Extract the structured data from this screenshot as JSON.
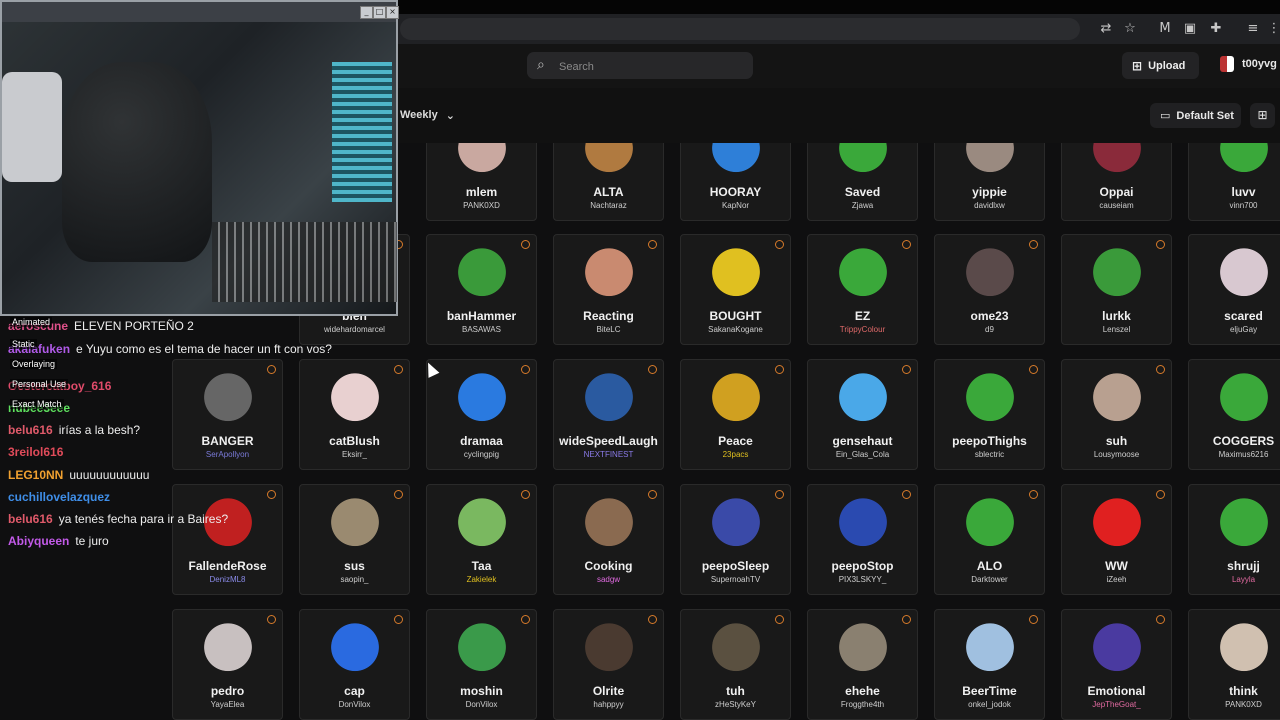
{
  "header": {
    "search_placeholder": "Search",
    "upload_label": "Upload",
    "username": "t00yvg",
    "period_label": "Weekly",
    "set_label": "Default Set"
  },
  "overlay_menu": [
    "Animated",
    "Static",
    "Overlaying",
    "Personal Use",
    "Exact Match"
  ],
  "chat": [
    {
      "user": "aeroscune",
      "text": "ELEVEN PORTEÑO 2",
      "color": "#e0508a"
    },
    {
      "user": "akalafuken",
      "text": "e Yuyu como es el tema de hacer un ft con vos?",
      "color": "#b05ae8"
    },
    {
      "user": "Oestercatboy_616",
      "text": "",
      "color": "#e04b6a"
    },
    {
      "user": "nubee3eee",
      "text": "",
      "color": "#5ee05e"
    },
    {
      "user": "belu616",
      "text": "irías a la besh?",
      "color": "#e05a6a"
    },
    {
      "user": "3reilol616",
      "text": "",
      "color": "#e04b5a"
    },
    {
      "user": "LEG10NN",
      "text": "uuuuuuuuuuuu",
      "color": "#f0a030"
    },
    {
      "user": "cuchillovelazquez",
      "text": "",
      "color": "#3f8ee8"
    },
    {
      "user": "belu616",
      "text": "ya tenés fecha para ir a Baires?",
      "color": "#e05a6a"
    },
    {
      "user": "Abiyqueen",
      "text": "te juro",
      "color": "#c25ae8"
    }
  ],
  "emotes": [
    {
      "name": "mlem",
      "author": "PANK0XD",
      "author_color": "#cfcfcf",
      "thumb": "#c9a8a0"
    },
    {
      "name": "ALTA",
      "author": "Nachtaraz",
      "author_color": "#cfcfcf",
      "thumb": "#b07a40"
    },
    {
      "name": "HOORAY",
      "author": "KapNor",
      "author_color": "#cfcfcf",
      "thumb": "#2e7fd8"
    },
    {
      "name": "Saved",
      "author": "Zjawa",
      "author_color": "#cfcfcf",
      "thumb": "#3aa83a"
    },
    {
      "name": "yippie",
      "author": "davidlxw",
      "author_color": "#cfcfcf",
      "thumb": "#9a8a80"
    },
    {
      "name": "Oppai",
      "author": "causeiam",
      "author_color": "#cfcfcf",
      "thumb": "#8a2a3a"
    },
    {
      "name": "luvv",
      "author": "vinn700",
      "author_color": "#cfcfcf",
      "thumb": "#3aa83a"
    },
    {
      "name": "bien",
      "author": "widehardomarcel",
      "author_color": "#cfcfcf",
      "thumb": "#777"
    },
    {
      "name": "banHammer",
      "author": "BASAWAS",
      "author_color": "#cfcfcf",
      "thumb": "#3a9a3a"
    },
    {
      "name": "Reacting",
      "author": "BiteLC",
      "author_color": "#cfcfcf",
      "thumb": "#c98a70"
    },
    {
      "name": "BOUGHT",
      "author": "SakanaKogane",
      "author_color": "#cfcfcf",
      "thumb": "#e0c020"
    },
    {
      "name": "EZ",
      "author": "TrippyColour",
      "author_color": "#e06a6a",
      "thumb": "#3aa83a"
    },
    {
      "name": "ome23",
      "author": "d9",
      "author_color": "#cfcfcf",
      "thumb": "#5a4a4a"
    },
    {
      "name": "lurkk",
      "author": "Lenszel",
      "author_color": "#cfcfcf",
      "thumb": "#3a9a3a"
    },
    {
      "name": "scared",
      "author": "eljuGay",
      "author_color": "#cfcfcf",
      "thumb": "#d8c8d0"
    },
    {
      "name": "BANGER",
      "author": "SerApollyon",
      "author_color": "#7a7ad8",
      "thumb": "#666"
    },
    {
      "name": "catBlush",
      "author": "Eksirr_",
      "author_color": "#cfcfcf",
      "thumb": "#e8d0d0"
    },
    {
      "name": "dramaa",
      "author": "cyclingpig",
      "author_color": "#cfcfcf",
      "thumb": "#2a7ae0"
    },
    {
      "name": "wideSpeedLaugh",
      "author": "NEXTFINEST",
      "author_color": "#8a7ae8",
      "thumb": "#2a5aa0"
    },
    {
      "name": "Peace",
      "author": "23pacs",
      "author_color": "#e0c020",
      "thumb": "#d0a020"
    },
    {
      "name": "gensehaut",
      "author": "Ein_Glas_Cola",
      "author_color": "#cfcfcf",
      "thumb": "#4aa8e8"
    },
    {
      "name": "peepoThighs",
      "author": "sblectric",
      "author_color": "#cfcfcf",
      "thumb": "#3aa83a"
    },
    {
      "name": "suh",
      "author": "Lousymoose",
      "author_color": "#cfcfcf",
      "thumb": "#b8a090"
    },
    {
      "name": "COGGERS",
      "author": "Maximus6216",
      "author_color": "#cfcfcf",
      "thumb": "#3aa83a"
    },
    {
      "name": "FallendeRose",
      "author": "DenizML8",
      "author_color": "#8a8ae8",
      "thumb": "#c02020"
    },
    {
      "name": "sus",
      "author": "saopin_",
      "author_color": "#cfcfcf",
      "thumb": "#9a8a70"
    },
    {
      "name": "Taa",
      "author": "Zakielek",
      "author_color": "#e0c020",
      "thumb": "#7ab860"
    },
    {
      "name": "Cooking",
      "author": "sadgw",
      "author_color": "#e06ae0",
      "thumb": "#8a6a50"
    },
    {
      "name": "peepoSleep",
      "author": "SupernoahTV",
      "author_color": "#cfcfcf",
      "thumb": "#3a4aa8"
    },
    {
      "name": "peepoStop",
      "author": "PIX3LSKYY_",
      "author_color": "#cfcfcf",
      "thumb": "#2a4ab0"
    },
    {
      "name": "ALO",
      "author": "Darktower",
      "author_color": "#cfcfcf",
      "thumb": "#3aa83a"
    },
    {
      "name": "WW",
      "author": "iZeeh",
      "author_color": "#cfcfcf",
      "thumb": "#e02020"
    },
    {
      "name": "shrujj",
      "author": "Layyla",
      "author_color": "#e06aa0",
      "thumb": "#3aa83a"
    },
    {
      "name": "pedro",
      "author": "YayaElea",
      "author_color": "#cfcfcf",
      "thumb": "#c8c0c0"
    },
    {
      "name": "cap",
      "author": "DonVilox",
      "author_color": "#cfcfcf",
      "thumb": "#2a6ae0"
    },
    {
      "name": "moshin",
      "author": "DonVilox",
      "author_color": "#cfcfcf",
      "thumb": "#3a9a4a"
    },
    {
      "name": "Olrite",
      "author": "hahppyy",
      "author_color": "#cfcfcf",
      "thumb": "#4a3a30"
    },
    {
      "name": "tuh",
      "author": "zHeStyKeY",
      "author_color": "#cfcfcf",
      "thumb": "#5a5040"
    },
    {
      "name": "ehehe",
      "author": "Froggthe4th",
      "author_color": "#cfcfcf",
      "thumb": "#8a8070"
    },
    {
      "name": "BeerTime",
      "author": "onkel_jodok",
      "author_color": "#cfcfcf",
      "thumb": "#a0c0e0"
    },
    {
      "name": "Emotional",
      "author": "JepTheGoat_",
      "author_color": "#e06aa0",
      "thumb": "#4a3aa0"
    },
    {
      "name": "think",
      "author": "PANK0XD",
      "author_color": "#cfcfcf",
      "thumb": "#d0c0b0"
    }
  ]
}
